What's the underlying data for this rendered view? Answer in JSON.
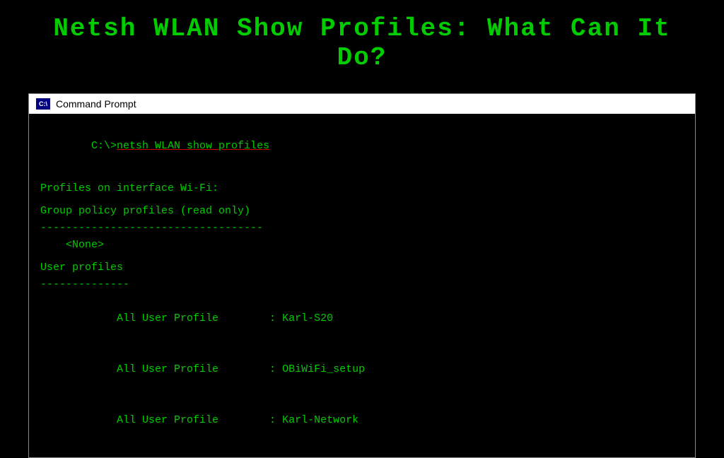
{
  "page": {
    "title": "Netsh WLAN Show Profiles: What Can It Do?",
    "background_color": "#000000",
    "text_color": "#00cc00"
  },
  "cmd_window": {
    "titlebar_label": "Command Prompt",
    "icon_label": "C:\\",
    "lines": {
      "prompt": "C:\\>",
      "command": "netsh WLAN show profiles",
      "line1": "Profiles on interface Wi-Fi:",
      "line2": "",
      "line3": "Group policy profiles (read only)",
      "separator1": "-----------------------------------",
      "none": "    <None>",
      "line4": "",
      "line5": "User profiles",
      "separator2": "--------------",
      "profile1_label": "    All User Profile",
      "profile1_sep": ":",
      "profile1_value": "Karl-S20",
      "profile2_label": "    All User Profile",
      "profile2_sep": ":",
      "profile2_value": "OBiWiFi_setup",
      "profile3_label": "    All User Profile",
      "profile3_sep": ":",
      "profile3_value": "Karl-Network"
    }
  }
}
